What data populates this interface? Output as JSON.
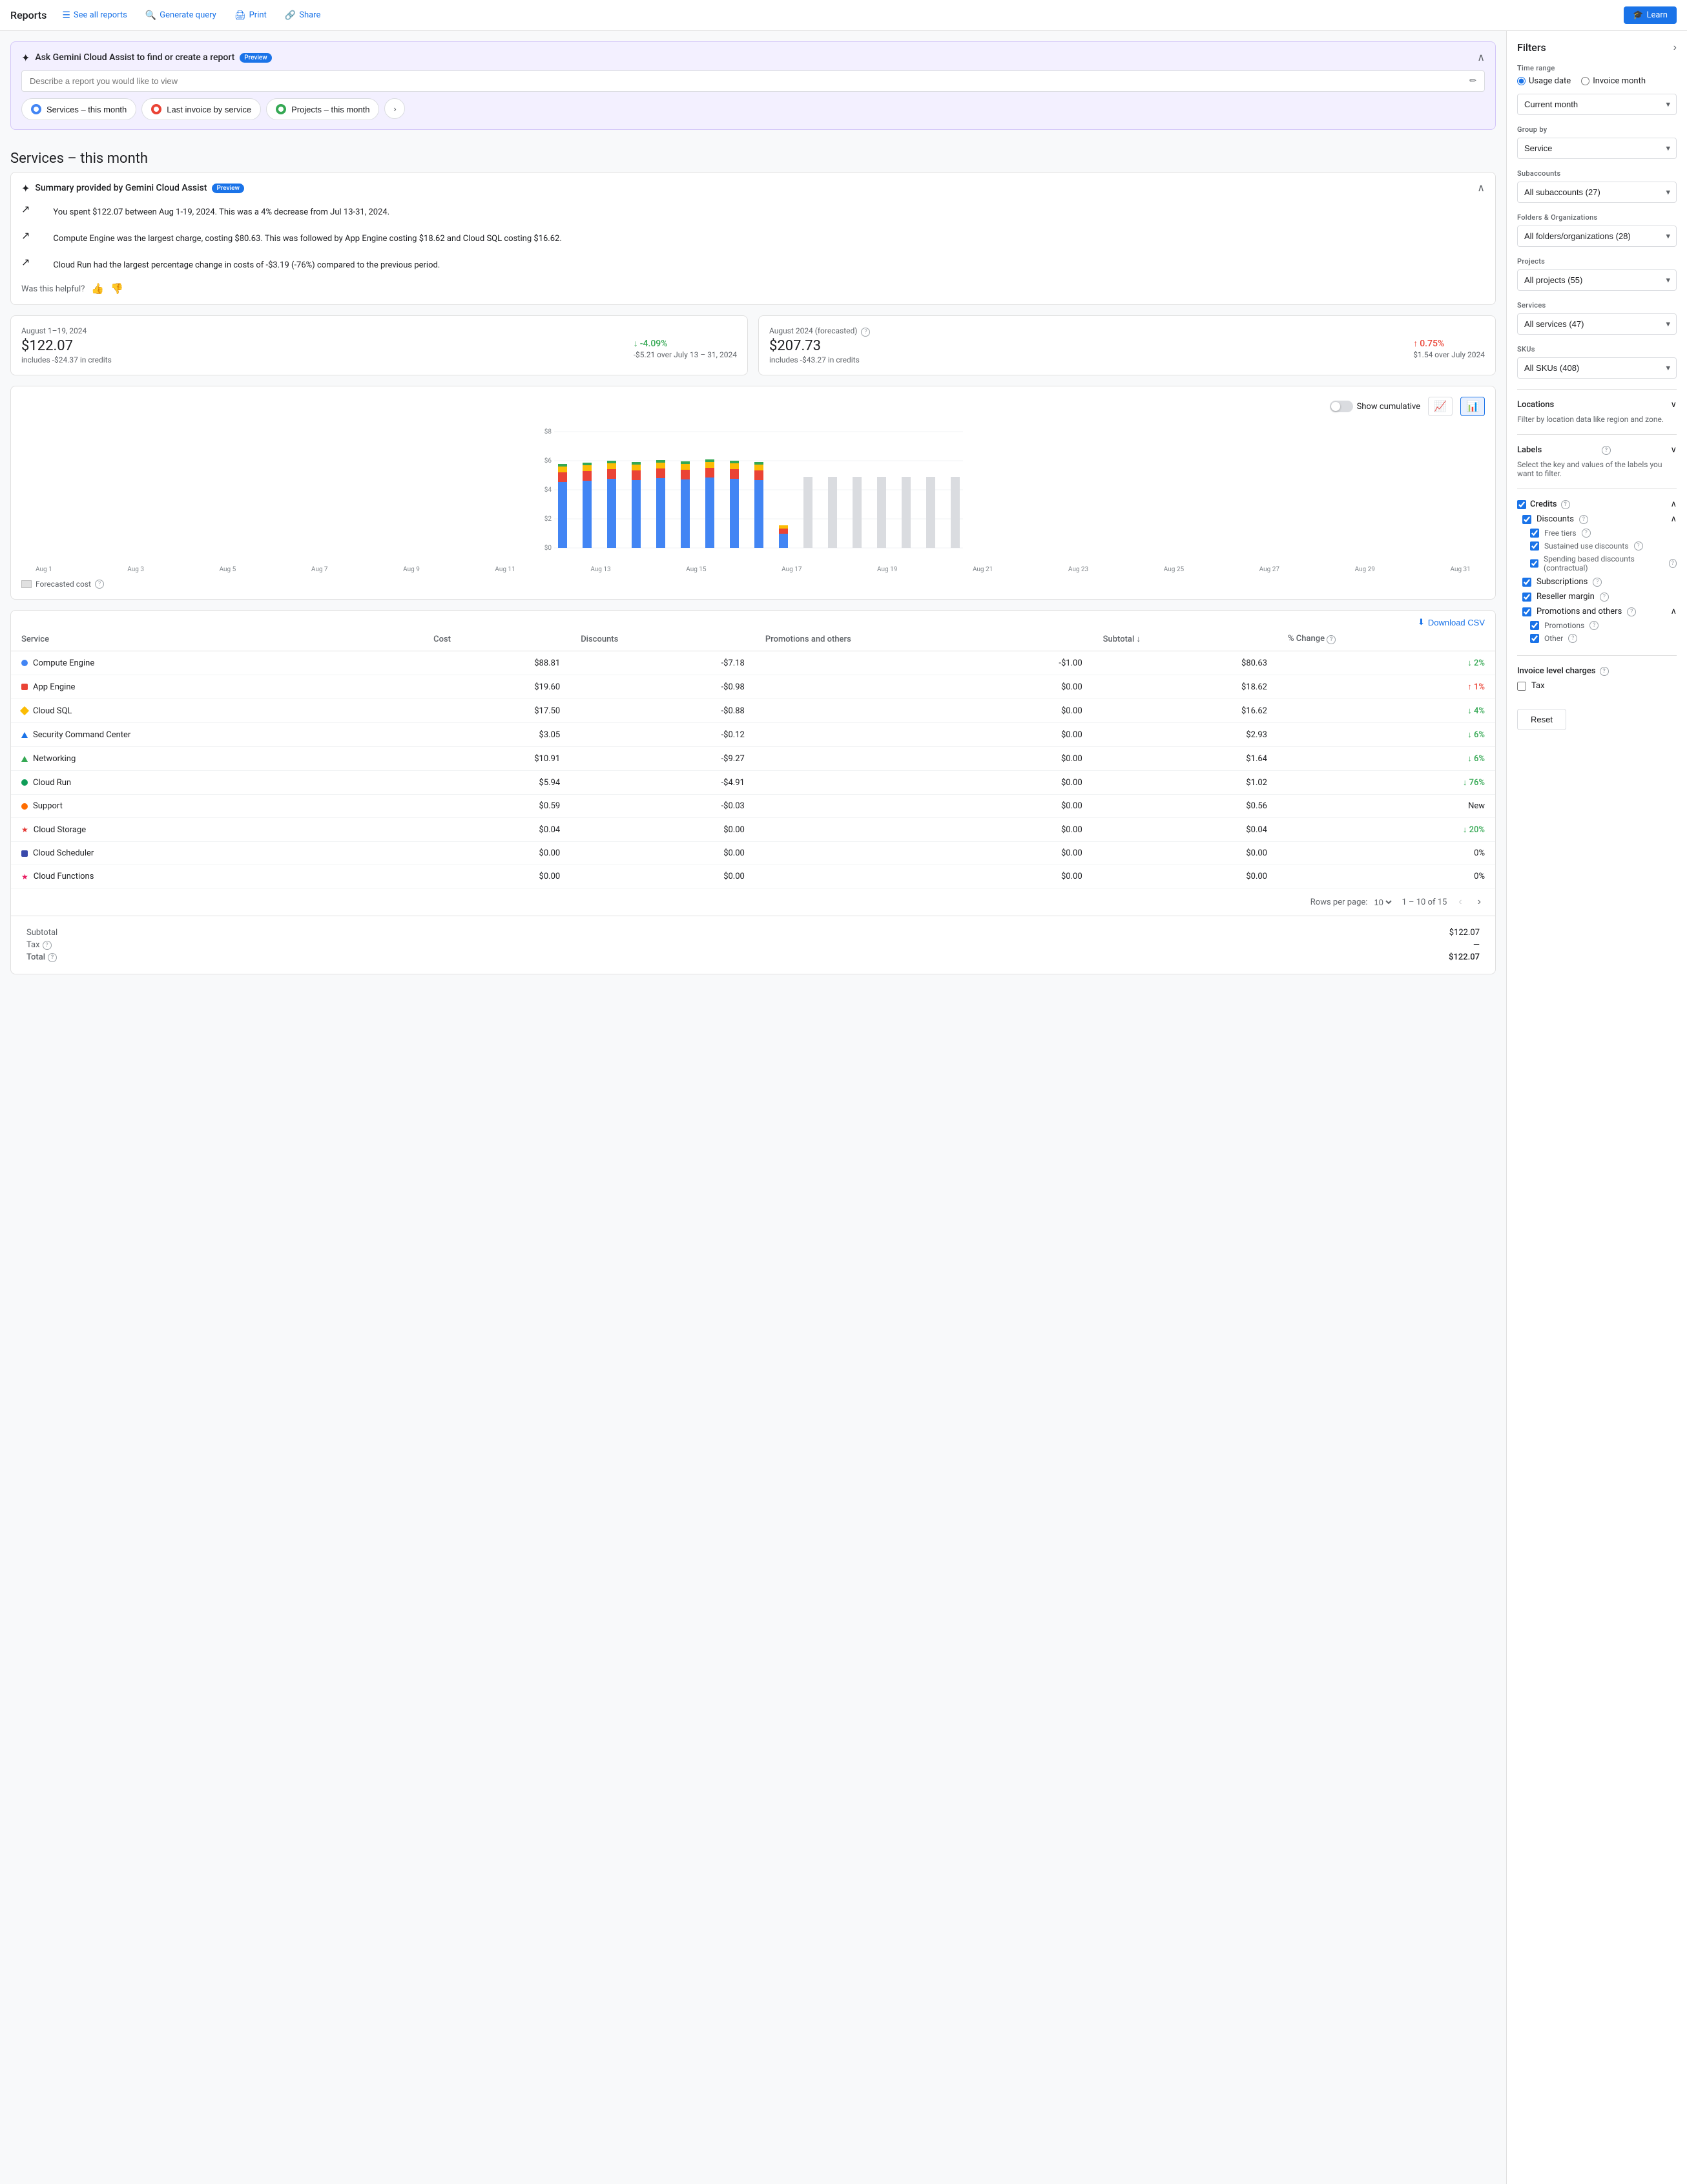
{
  "nav": {
    "brand": "Reports",
    "see_all_reports": "See all reports",
    "generate_query": "Generate query",
    "print": "Print",
    "share": "Share",
    "learn": "Learn"
  },
  "gemini": {
    "title": "Ask Gemini Cloud Assist to find or create a report",
    "preview": "Preview",
    "input_placeholder": "Describe a report you would like to view",
    "quick_reports": [
      "Services – this month",
      "Last invoice by service",
      "Projects – this month"
    ]
  },
  "page_title": "Services – this month",
  "summary": {
    "title": "Summary provided by Gemini Cloud Assist",
    "preview": "Preview",
    "lines": [
      "You spent $122.07 between Aug 1-19, 2024. This was a 4% decrease from Jul 13-31, 2024.",
      "Compute Engine was the largest charge, costing $80.63. This was followed by App Engine costing $18.62 and Cloud SQL costing $16.62.",
      "Cloud Run had the largest percentage change in costs of -$3.19 (-76%) compared to the previous period."
    ],
    "helpful": "Was this helpful?"
  },
  "metrics": {
    "current": {
      "period": "August 1–19, 2024",
      "value": "$122.07",
      "sub": "includes -$24.37 in credits",
      "change": "-4.09%",
      "change_label": "-$5.21 over July 13 – 31, 2024",
      "change_direction": "down"
    },
    "forecasted": {
      "period": "August 2024 (forecasted)",
      "value": "$207.73",
      "sub": "includes -$43.27 in credits",
      "change": "0.75%",
      "change_label": "$1.54 over July 2024",
      "change_direction": "up"
    }
  },
  "chart": {
    "show_cumulative": "Show cumulative",
    "y_labels": [
      "$8",
      "$6",
      "$4",
      "$2",
      "$0"
    ],
    "x_labels": [
      "Aug 1",
      "Aug 3",
      "Aug 5",
      "Aug 7",
      "Aug 9",
      "Aug 11",
      "Aug 13",
      "Aug 15",
      "Aug 17",
      "Aug 19",
      "Aug 21",
      "Aug 23",
      "Aug 25",
      "Aug 27",
      "Aug 29",
      "Aug 31"
    ],
    "forecasted_label": "Forecasted cost"
  },
  "table": {
    "download_csv": "Download CSV",
    "headers": [
      "Service",
      "Cost",
      "Discounts",
      "Promotions and others",
      "Subtotal",
      "% Change"
    ],
    "rows": [
      {
        "service": "Compute Engine",
        "cost": "$88.81",
        "discounts": "-$7.18",
        "promos": "-$1.00",
        "subtotal": "$80.63",
        "change": "2%",
        "change_dir": "down",
        "color": "#4285f4",
        "shape": "circle"
      },
      {
        "service": "App Engine",
        "cost": "$19.60",
        "discounts": "-$0.98",
        "promos": "$0.00",
        "subtotal": "$18.62",
        "change": "1%",
        "change_dir": "up",
        "color": "#ea4335",
        "shape": "square"
      },
      {
        "service": "Cloud SQL",
        "cost": "$17.50",
        "discounts": "-$0.88",
        "promos": "$0.00",
        "subtotal": "$16.62",
        "change": "4%",
        "change_dir": "down",
        "color": "#fbbc04",
        "shape": "diamond"
      },
      {
        "service": "Security Command Center",
        "cost": "$3.05",
        "discounts": "-$0.12",
        "promos": "$0.00",
        "subtotal": "$2.93",
        "change": "6%",
        "change_dir": "down",
        "color": "#1a73e8",
        "shape": "triangle"
      },
      {
        "service": "Networking",
        "cost": "$10.91",
        "discounts": "-$9.27",
        "promos": "$0.00",
        "subtotal": "$1.64",
        "change": "6%",
        "change_dir": "down",
        "color": "#34a853",
        "shape": "triangle"
      },
      {
        "service": "Cloud Run",
        "cost": "$5.94",
        "discounts": "-$4.91",
        "promos": "$0.00",
        "subtotal": "$1.02",
        "change": "76%",
        "change_dir": "down",
        "color": "#0f9d58",
        "shape": "circle"
      },
      {
        "service": "Support",
        "cost": "$0.59",
        "discounts": "-$0.03",
        "promos": "$0.00",
        "subtotal": "$0.56",
        "change": "New",
        "change_dir": "neutral",
        "color": "#ff6d00",
        "shape": "circle"
      },
      {
        "service": "Cloud Storage",
        "cost": "$0.04",
        "discounts": "$0.00",
        "promos": "$0.00",
        "subtotal": "$0.04",
        "change": "20%",
        "change_dir": "down",
        "color": "#e53935",
        "shape": "star"
      },
      {
        "service": "Cloud Scheduler",
        "cost": "$0.00",
        "discounts": "$0.00",
        "promos": "$0.00",
        "subtotal": "$0.00",
        "change": "0%",
        "change_dir": "neutral",
        "color": "#3949ab",
        "shape": "square"
      },
      {
        "service": "Cloud Functions",
        "cost": "$0.00",
        "discounts": "$0.00",
        "promos": "$0.00",
        "subtotal": "$0.00",
        "change": "0%",
        "change_dir": "neutral",
        "color": "#e91e63",
        "shape": "star"
      }
    ],
    "pagination": {
      "rows_per_page": "Rows per page:",
      "per_page": "10",
      "range": "1 – 10 of 15"
    }
  },
  "totals": {
    "subtotal_label": "Subtotal",
    "subtotal_value": "$122.07",
    "tax_label": "Tax",
    "tax_value": "—",
    "total_label": "Total",
    "total_value": "$122.07"
  },
  "filters": {
    "title": "Filters",
    "time_range_label": "Time range",
    "usage_date": "Usage date",
    "invoice_month": "Invoice month",
    "current_month": "Current month",
    "group_by_label": "Group by",
    "group_by_value": "Service",
    "subaccounts_label": "Subaccounts",
    "subaccounts_value": "All subaccounts (27)",
    "folders_label": "Folders & Organizations",
    "folders_value": "All folders/organizations (28)",
    "projects_label": "Projects",
    "projects_value": "All projects (55)",
    "services_label": "Services",
    "services_value": "All services (47)",
    "skus_label": "SKUs",
    "skus_value": "All SKUs (408)",
    "locations_label": "Locations",
    "locations_desc": "Filter by location data like region and zone.",
    "labels_label": "Labels",
    "labels_desc": "Select the key and values of the labels you want to filter.",
    "credits_label": "Credits",
    "discounts_label": "Discounts",
    "free_tiers": "Free tiers",
    "sustained_use": "Sustained use discounts",
    "spending_based": "Spending based discounts (contractual)",
    "subscriptions": "Subscriptions",
    "reseller_margin": "Reseller margin",
    "promotions_label": "Promotions and others",
    "promotions": "Promotions",
    "other": "Other",
    "invoice_charges_label": "Invoice level charges",
    "tax_label": "Tax",
    "reset_label": "Reset"
  }
}
